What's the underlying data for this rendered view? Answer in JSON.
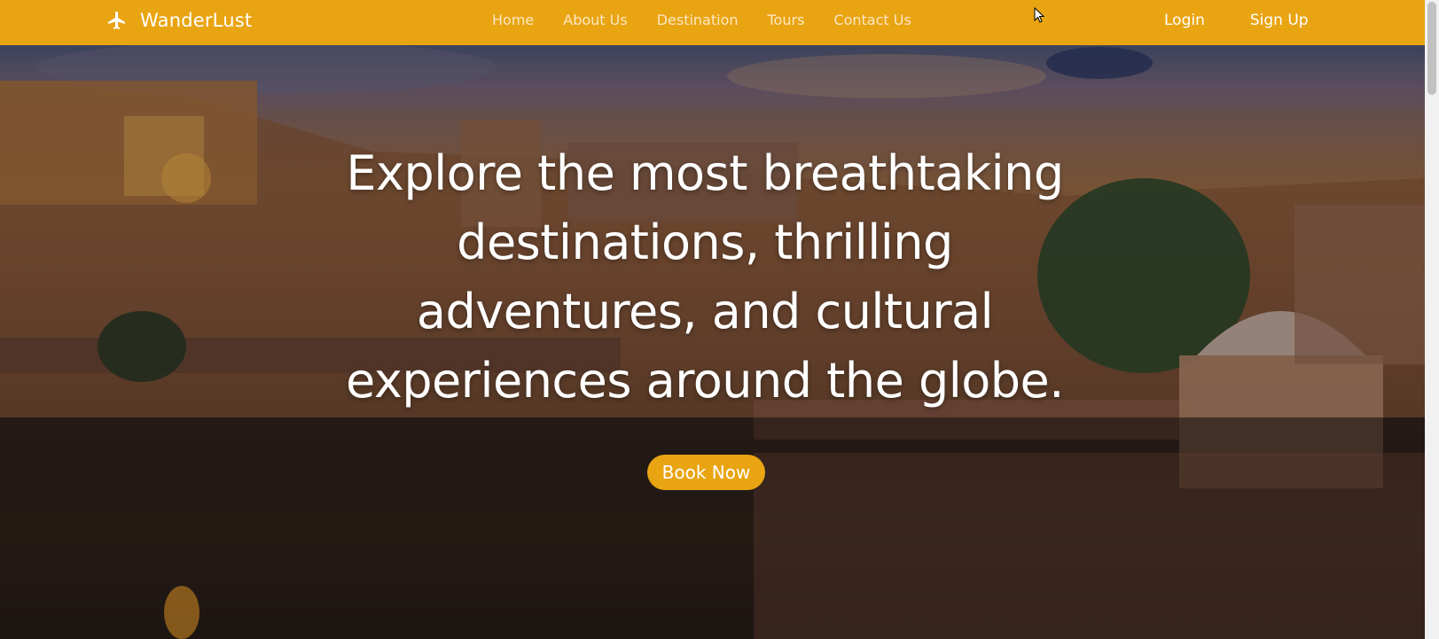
{
  "brand": {
    "name": "WanderLust",
    "icon": "airplane-icon"
  },
  "nav": {
    "links": [
      "Home",
      "About Us",
      "Destination",
      "Tours",
      "Contact Us"
    ],
    "login": "Login",
    "signup": "Sign Up"
  },
  "hero": {
    "headline": "Explore the most breathtaking destinations, thrilling adventures, and cultural experiences around the globe.",
    "cta": "Book Now"
  },
  "colors": {
    "accent": "#e9a412",
    "nav_link": "#fbe7c2",
    "text": "#ffffff"
  }
}
